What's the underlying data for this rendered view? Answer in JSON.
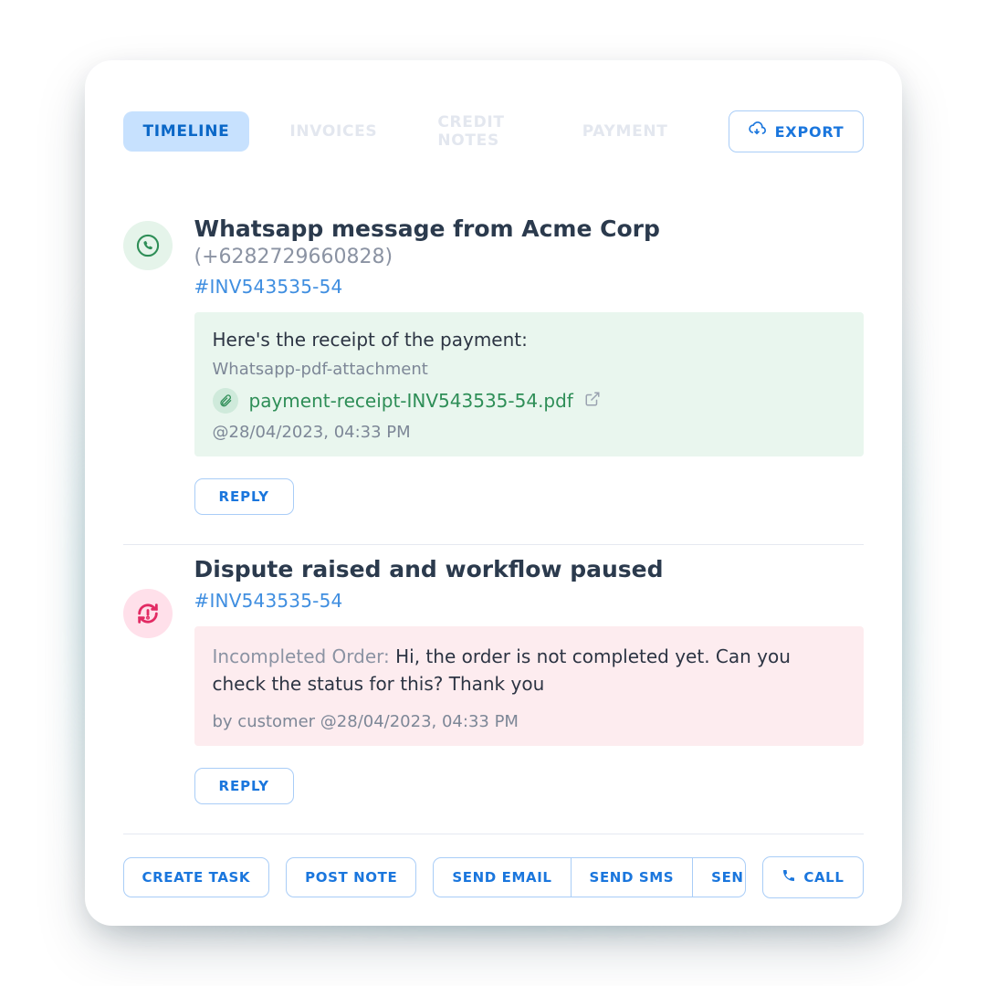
{
  "tabs": {
    "timeline": "TIMELINE",
    "invoices": "INVOICES",
    "credit_notes": "CREDIT NOTES",
    "payment": "PAYMENT"
  },
  "export_label": "EXPORT",
  "item1": {
    "title_prefix": "Whatsapp message from Acme Corp ",
    "phone": "(+6282729660828)",
    "invoice": "#INV543535-54",
    "msg": "Here's the receipt of the payment:",
    "att_label": "Whatsapp-pdf-attachment",
    "att_name": "payment-receipt-INV543535-54.pdf",
    "stamp": "@28/04/2023, 04:33 PM",
    "reply": "REPLY"
  },
  "item2": {
    "title": "Dispute raised and workflow paused",
    "invoice": "#INV543535-54",
    "lead": "Incompleted Order: ",
    "body": "Hi, the order is not completed yet. Can you check the status for this? Thank you",
    "by": "by customer @28/04/2023, 04:33 PM",
    "reply": "REPLY"
  },
  "actions": {
    "create_task": "CREATE TASK",
    "post_note": "POST NOTE",
    "send_email": "SEND EMAIL",
    "send_sms": "SEND SMS",
    "send_whatsapp": "SEND WHATSAPP",
    "call": "CALL"
  }
}
